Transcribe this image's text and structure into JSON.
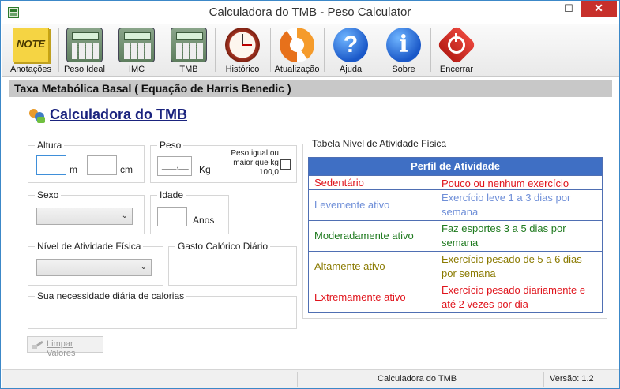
{
  "window": {
    "title": "Calculadora do TMB - Peso Calculator"
  },
  "window_controls": {
    "minimize": "—",
    "maximize": "☐",
    "close": "✕"
  },
  "toolbar": {
    "items": [
      {
        "label": "Anotações",
        "icon": "note-icon"
      },
      {
        "label": "Peso Ideal",
        "icon": "calculator-icon"
      },
      {
        "label": "IMC",
        "icon": "calculator-icon"
      },
      {
        "label": "TMB",
        "icon": "calculator-icon"
      },
      {
        "label": "Histórico",
        "icon": "clock-icon"
      },
      {
        "label": "Atualização",
        "icon": "refresh-icon"
      },
      {
        "label": "Ajuda",
        "icon": "help-icon"
      },
      {
        "label": "Sobre",
        "icon": "info-icon"
      },
      {
        "label": "Encerrar",
        "icon": "power-icon"
      }
    ],
    "note_icon_text": "NOTE",
    "help_glyph": "?",
    "info_glyph": "i"
  },
  "section_header": "Taxa Metabólica Basal ( Equação de Harris Benedic )",
  "calc_title": "Calculadora do TMB",
  "altura": {
    "label": "Altura",
    "unit_m": "m",
    "unit_cm": "cm",
    "value_m": "",
    "value_cm": ""
  },
  "peso": {
    "label": "Peso",
    "mask": "___,__",
    "unit": "Kg",
    "check_label": "Peso igual ou maior que kg 100,0"
  },
  "sexo": {
    "label": "Sexo",
    "selected": ""
  },
  "idade": {
    "label": "Idade",
    "unit": "Anos",
    "value": ""
  },
  "nivel": {
    "label": "Nível de Atividade Física",
    "selected": ""
  },
  "gasto": {
    "label": "Gasto Calórico Diário",
    "value": ""
  },
  "necessidade": {
    "label": "Sua necessidade diária de calorias",
    "value": ""
  },
  "clear_button": "Limpar Valores",
  "activity_table": {
    "group_label": "Tabela Nível de Atividade Física",
    "header": "Perfil de Atividade",
    "rows": [
      {
        "level": "Sedentário",
        "desc": "Pouco ou nenhum exercício",
        "color": "#e0141c"
      },
      {
        "level": "Levemente ativo",
        "desc": "Exercício leve 1 a 3 dias por semana",
        "color": "#6f8fd8"
      },
      {
        "level": "Moderadamente ativo",
        "desc": "Faz esportes 3 a 5 dias por semana",
        "color": "#1f7a1f"
      },
      {
        "level": "Altamente ativo",
        "desc": "Exercício pesado de 5 a 6 dias por semana",
        "color": "#8a7a00"
      },
      {
        "level": "Extremamente ativo",
        "desc": "Exercício pesado diariamente e até 2 vezes por dia",
        "color": "#e0141c"
      }
    ]
  },
  "statusbar": {
    "center": "Calculadora do TMB",
    "version": "Versão: 1.2"
  }
}
